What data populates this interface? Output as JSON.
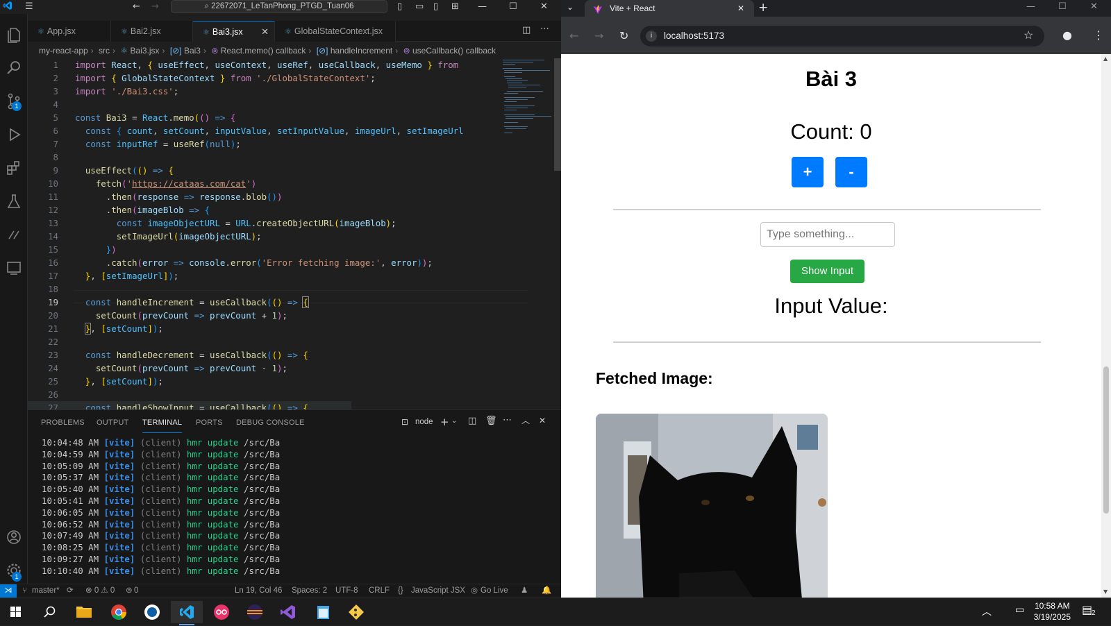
{
  "vscode": {
    "search_text": "22672071_LeTanPhong_PTGD_Tuan06",
    "tabs": [
      "App.jsx",
      "Bai2.jsx",
      "Bai3.jsx",
      "GlobalStateContext.jsx"
    ],
    "breadcrumb": [
      "my-react-app",
      "src",
      "Bai3.jsx",
      "Bai3",
      "React.memo() callback",
      "handleIncrement",
      "useCallback() callback"
    ],
    "line_numbers": [
      "1",
      "2",
      "3",
      "4",
      "5",
      "6",
      "7",
      "8",
      "9",
      "10",
      "11",
      "12",
      "13",
      "14",
      "15",
      "16",
      "17",
      "18",
      "19",
      "20",
      "21",
      "22",
      "23",
      "24",
      "25",
      "26",
      "27"
    ],
    "panel_tabs": [
      "PROBLEMS",
      "OUTPUT",
      "TERMINAL",
      "PORTS",
      "DEBUG CONSOLE"
    ],
    "terminal_shell": "node",
    "terminal_lines": [
      {
        "time": "10:04:48 AM",
        "tag": "[vite]",
        "client": "(client)",
        "msg": "hmr update",
        "path": "/src/Ba"
      },
      {
        "time": "10:04:59 AM",
        "tag": "[vite]",
        "client": "(client)",
        "msg": "hmr update",
        "path": "/src/Ba"
      },
      {
        "time": "10:05:09 AM",
        "tag": "[vite]",
        "client": "(client)",
        "msg": "hmr update",
        "path": "/src/Ba"
      },
      {
        "time": "10:05:37 AM",
        "tag": "[vite]",
        "client": "(client)",
        "msg": "hmr update",
        "path": "/src/Ba"
      },
      {
        "time": "10:05:40 AM",
        "tag": "[vite]",
        "client": "(client)",
        "msg": "hmr update",
        "path": "/src/Ba"
      },
      {
        "time": "10:05:41 AM",
        "tag": "[vite]",
        "client": "(client)",
        "msg": "hmr update",
        "path": "/src/Ba"
      },
      {
        "time": "10:06:05 AM",
        "tag": "[vite]",
        "client": "(client)",
        "msg": "hmr update",
        "path": "/src/Ba"
      },
      {
        "time": "10:06:52 AM",
        "tag": "[vite]",
        "client": "(client)",
        "msg": "hmr update",
        "path": "/src/Ba"
      },
      {
        "time": "10:07:49 AM",
        "tag": "[vite]",
        "client": "(client)",
        "msg": "hmr update",
        "path": "/src/Ba"
      },
      {
        "time": "10:08:25 AM",
        "tag": "[vite]",
        "client": "(client)",
        "msg": "hmr update",
        "path": "/src/Ba"
      },
      {
        "time": "10:09:27 AM",
        "tag": "[vite]",
        "client": "(client)",
        "msg": "hmr update",
        "path": "/src/Ba"
      },
      {
        "time": "10:10:40 AM",
        "tag": "[vite]",
        "client": "(client)",
        "msg": "hmr update",
        "path": "/src/Ba"
      }
    ],
    "status": {
      "branch": "master*",
      "problems": "⊗ 0 ⚠ 0",
      "ports": "0",
      "cursor": "Ln 19, Col 46",
      "spaces": "Spaces: 2",
      "encoding": "UTF-8",
      "eol": "CRLF",
      "language": "JavaScript JSX",
      "golive": "Go Live"
    },
    "badges": {
      "scm": "1",
      "settings": "1"
    }
  },
  "browser": {
    "tab_title": "Vite + React",
    "url": "localhost:5173",
    "page": {
      "heading": "Bài 3",
      "count_label": "Count: 0",
      "increment_label": "+",
      "decrement_label": "-",
      "input_placeholder": "Type something...",
      "show_input_label": "Show Input",
      "input_value_label": "Input Value:",
      "fetched_image_label": "Fetched Image:"
    }
  },
  "taskbar": {
    "time": "10:58 AM",
    "date": "3/19/2025",
    "notifications": "2"
  },
  "colors": {
    "vscode_bg": "#1f1f1f",
    "accent": "#0078d4",
    "btn_blue": "#007bff",
    "btn_green": "#28a745"
  }
}
